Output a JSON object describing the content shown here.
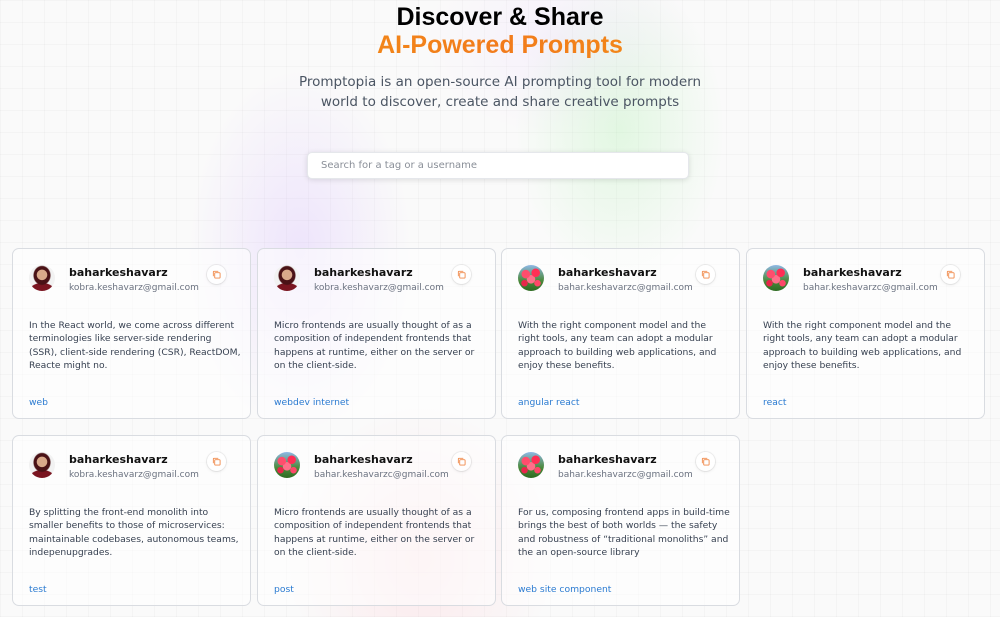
{
  "hero": {
    "title_line1": "Discover & Share",
    "title_line2": "AI-Powered Prompts",
    "subtitle": "Promptopia is an open-source AI prompting tool for modern world to discover, create and share creative prompts"
  },
  "search": {
    "placeholder": "Search for a tag or a username",
    "value": ""
  },
  "colors": {
    "accent_gradient": [
      "#f4a40e",
      "#f27b1c"
    ],
    "tag_link": "#2b7bd1"
  },
  "cards": [
    {
      "avatar": "portrait-avatar",
      "username": "baharkeshavarz",
      "email": "kobra.keshavarz@gmail.com",
      "prompt": "In the React world, we come across different terminologies like server-side rendering (SSR), client-side rendering (CSR), ReactDOM, Reacte might no.",
      "tags": "web"
    },
    {
      "avatar": "portrait-avatar",
      "username": "baharkeshavarz",
      "email": "kobra.keshavarz@gmail.com",
      "prompt": "Micro frontends are usually thought of as a composition of independent frontends that happens at runtime, either on the server or on the client-side.",
      "tags": "webdev internet"
    },
    {
      "avatar": "flowers-avatar",
      "username": "baharkeshavarz",
      "email": "bahar.keshavarzc@gmail.com",
      "prompt": "With the right component model and the right tools, any team can adopt a modular approach to building web applications, and enjoy these benefits.",
      "tags": "angular react"
    },
    {
      "avatar": "flowers-avatar",
      "username": "baharkeshavarz",
      "email": "bahar.keshavarzc@gmail.com",
      "prompt": "With the right component model and the right tools, any team can adopt a modular approach to building web applications, and enjoy these benefits.",
      "tags": "react"
    },
    {
      "avatar": "portrait-avatar",
      "username": "baharkeshavarz",
      "email": "kobra.keshavarz@gmail.com",
      "prompt": "By splitting the front-end monolith into smaller benefits to those of microservices: maintainable codebases, autonomous teams, indepenupgrades.",
      "tags": "test"
    },
    {
      "avatar": "flowers-avatar",
      "username": "baharkeshavarz",
      "email": "bahar.keshavarzc@gmail.com",
      "prompt": "Micro frontends are usually thought of as a composition of independent frontends that happens at runtime, either on the server or on the client-side.",
      "tags": "post"
    },
    {
      "avatar": "flowers-avatar",
      "username": "baharkeshavarz",
      "email": "bahar.keshavarzc@gmail.com",
      "prompt": "For us, composing frontend apps in build-time brings the best of both worlds — the safety and robustness of “traditional monoliths” and the an open-source library",
      "tags": "web site component"
    }
  ]
}
